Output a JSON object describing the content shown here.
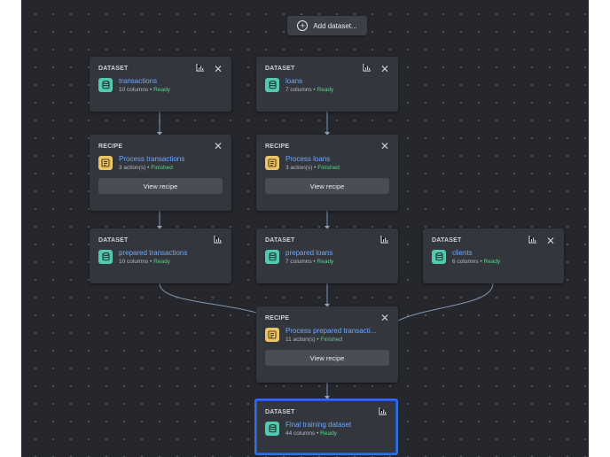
{
  "toolbar": {
    "add_dataset_label": "Add dataset..."
  },
  "nodes": {
    "transactions": {
      "kind": "DATASET",
      "title": "transactions",
      "meta": "10 columns",
      "status": "Ready",
      "icons": [
        "chart-icon",
        "close-icon"
      ]
    },
    "loans": {
      "kind": "DATASET",
      "title": "loans",
      "meta": "7 columns",
      "status": "Ready",
      "icons": [
        "chart-icon",
        "close-icon"
      ]
    },
    "recipe_transactions": {
      "kind": "RECIPE",
      "title": "Process transactions",
      "meta": "3 action(s)",
      "status": "Finished",
      "button": "View recipe",
      "icons": [
        "close-icon"
      ]
    },
    "recipe_loans": {
      "kind": "RECIPE",
      "title": "Process loans",
      "meta": "3 action(s)",
      "status": "Finished",
      "button": "View recipe",
      "icons": [
        "close-icon"
      ]
    },
    "prepared_transactions": {
      "kind": "DATASET",
      "title": "prepared transactions",
      "meta": "10 columns",
      "status": "Ready",
      "icons": [
        "chart-icon"
      ]
    },
    "prepared_loans": {
      "kind": "DATASET",
      "title": "prepared loans",
      "meta": "7 columns",
      "status": "Ready",
      "icons": [
        "chart-icon"
      ]
    },
    "clients": {
      "kind": "DATASET",
      "title": "clients",
      "meta": "6 columns",
      "status": "Ready",
      "icons": [
        "chart-icon",
        "close-icon"
      ]
    },
    "recipe_prepared": {
      "kind": "RECIPE",
      "title": "Process prepared transacti...",
      "meta": "11 action(s)",
      "status": "Finished",
      "button": "View recipe",
      "icons": [
        "close-icon"
      ]
    },
    "final": {
      "kind": "DATASET",
      "title": "Final training dataset",
      "meta": "44 columns",
      "status": "Ready",
      "icons": [
        "chart-icon"
      ]
    }
  },
  "colors": {
    "canvas": "#25272c",
    "node": "#33363d",
    "link": "#6fa8ff",
    "ready": "#5fd18a",
    "dataset_badge": "#53c9b1",
    "recipe_badge": "#e9c567",
    "selected_border": "#2f6fe0"
  }
}
